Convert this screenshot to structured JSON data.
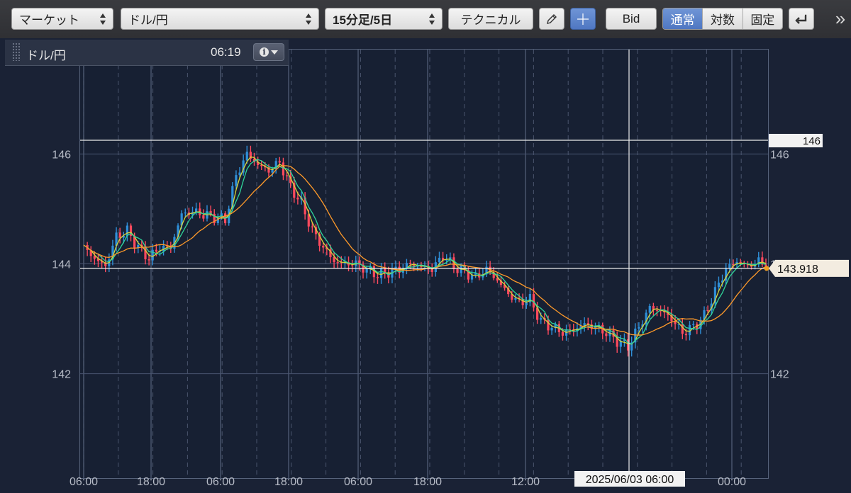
{
  "toolbar": {
    "market_label": "マーケット",
    "pair_label": "ドル/円",
    "timeframe_label": "15分足/5日",
    "technical_label": "テクニカル",
    "bid_label": "Bid",
    "scale_modes": [
      "通常",
      "対数",
      "固定"
    ],
    "active_scale_mode": "通常",
    "more_label": "»"
  },
  "infobox": {
    "pair": "ドル/円",
    "time": "06:19"
  },
  "crosshair": {
    "date_label": "2025/06/03 06:00",
    "price_label": "146"
  },
  "current_price_label": "143.918",
  "colors": {
    "background": "#1a2235",
    "bullish_candle": "#2f8fd8",
    "bearish_candle": "#ff4a5e",
    "ma_fast": "#d6d63a",
    "ma_mid": "#2fd59a",
    "ma_slow": "#ff9a2a",
    "active_button": "#5b84cc"
  },
  "chart_data": {
    "type": "line",
    "series_style": "candlestick with moving averages",
    "ylim": [
      140.1,
      147.9
    ],
    "y_ticks": [
      142,
      144,
      146
    ],
    "x_tick_labels": [
      "06:00",
      "18:00",
      "06:00",
      "18:00",
      "06:00",
      "18:00",
      "12:00",
      "00:00"
    ],
    "grid": true,
    "legend": "none",
    "horizontal_line": 143.918,
    "points": [
      [
        0,
        144.3
      ],
      [
        3,
        144.1
      ],
      [
        6,
        143.95
      ],
      [
        9,
        144.5
      ],
      [
        12,
        144.6
      ],
      [
        15,
        144.3
      ],
      [
        18,
        144.1
      ],
      [
        21,
        144.3
      ],
      [
        24,
        144.3
      ],
      [
        27,
        144.9
      ],
      [
        30,
        144.95
      ],
      [
        33,
        144.9
      ],
      [
        36,
        144.85
      ],
      [
        39,
        144.8
      ],
      [
        42,
        145.6
      ],
      [
        45,
        146.0
      ],
      [
        48,
        145.8
      ],
      [
        51,
        145.7
      ],
      [
        54,
        145.85
      ],
      [
        57,
        145.4
      ],
      [
        60,
        145.1
      ],
      [
        63,
        144.6
      ],
      [
        66,
        144.3
      ],
      [
        69,
        144.05
      ],
      [
        72,
        144.0
      ],
      [
        75,
        144.0
      ],
      [
        78,
        143.9
      ],
      [
        81,
        143.8
      ],
      [
        84,
        143.85
      ],
      [
        87,
        143.9
      ],
      [
        90,
        144.0
      ],
      [
        93,
        143.95
      ],
      [
        96,
        143.9
      ],
      [
        99,
        144.15
      ],
      [
        102,
        143.95
      ],
      [
        105,
        143.85
      ],
      [
        108,
        143.75
      ],
      [
        111,
        143.9
      ],
      [
        114,
        143.7
      ],
      [
        117,
        143.45
      ],
      [
        120,
        143.3
      ],
      [
        123,
        143.35
      ],
      [
        126,
        142.95
      ],
      [
        129,
        142.85
      ],
      [
        132,
        142.75
      ],
      [
        135,
        142.8
      ],
      [
        138,
        142.9
      ],
      [
        141,
        142.85
      ],
      [
        144,
        142.75
      ],
      [
        147,
        142.6
      ],
      [
        150,
        142.5
      ],
      [
        153,
        142.85
      ],
      [
        156,
        143.2
      ],
      [
        159,
        143.15
      ],
      [
        162,
        143.0
      ],
      [
        165,
        142.75
      ],
      [
        168,
        142.85
      ],
      [
        171,
        143.05
      ],
      [
        174,
        143.5
      ],
      [
        177,
        143.9
      ],
      [
        180,
        144.05
      ],
      [
        183,
        143.95
      ],
      [
        186,
        144.05
      ],
      [
        188,
        143.918
      ]
    ]
  }
}
